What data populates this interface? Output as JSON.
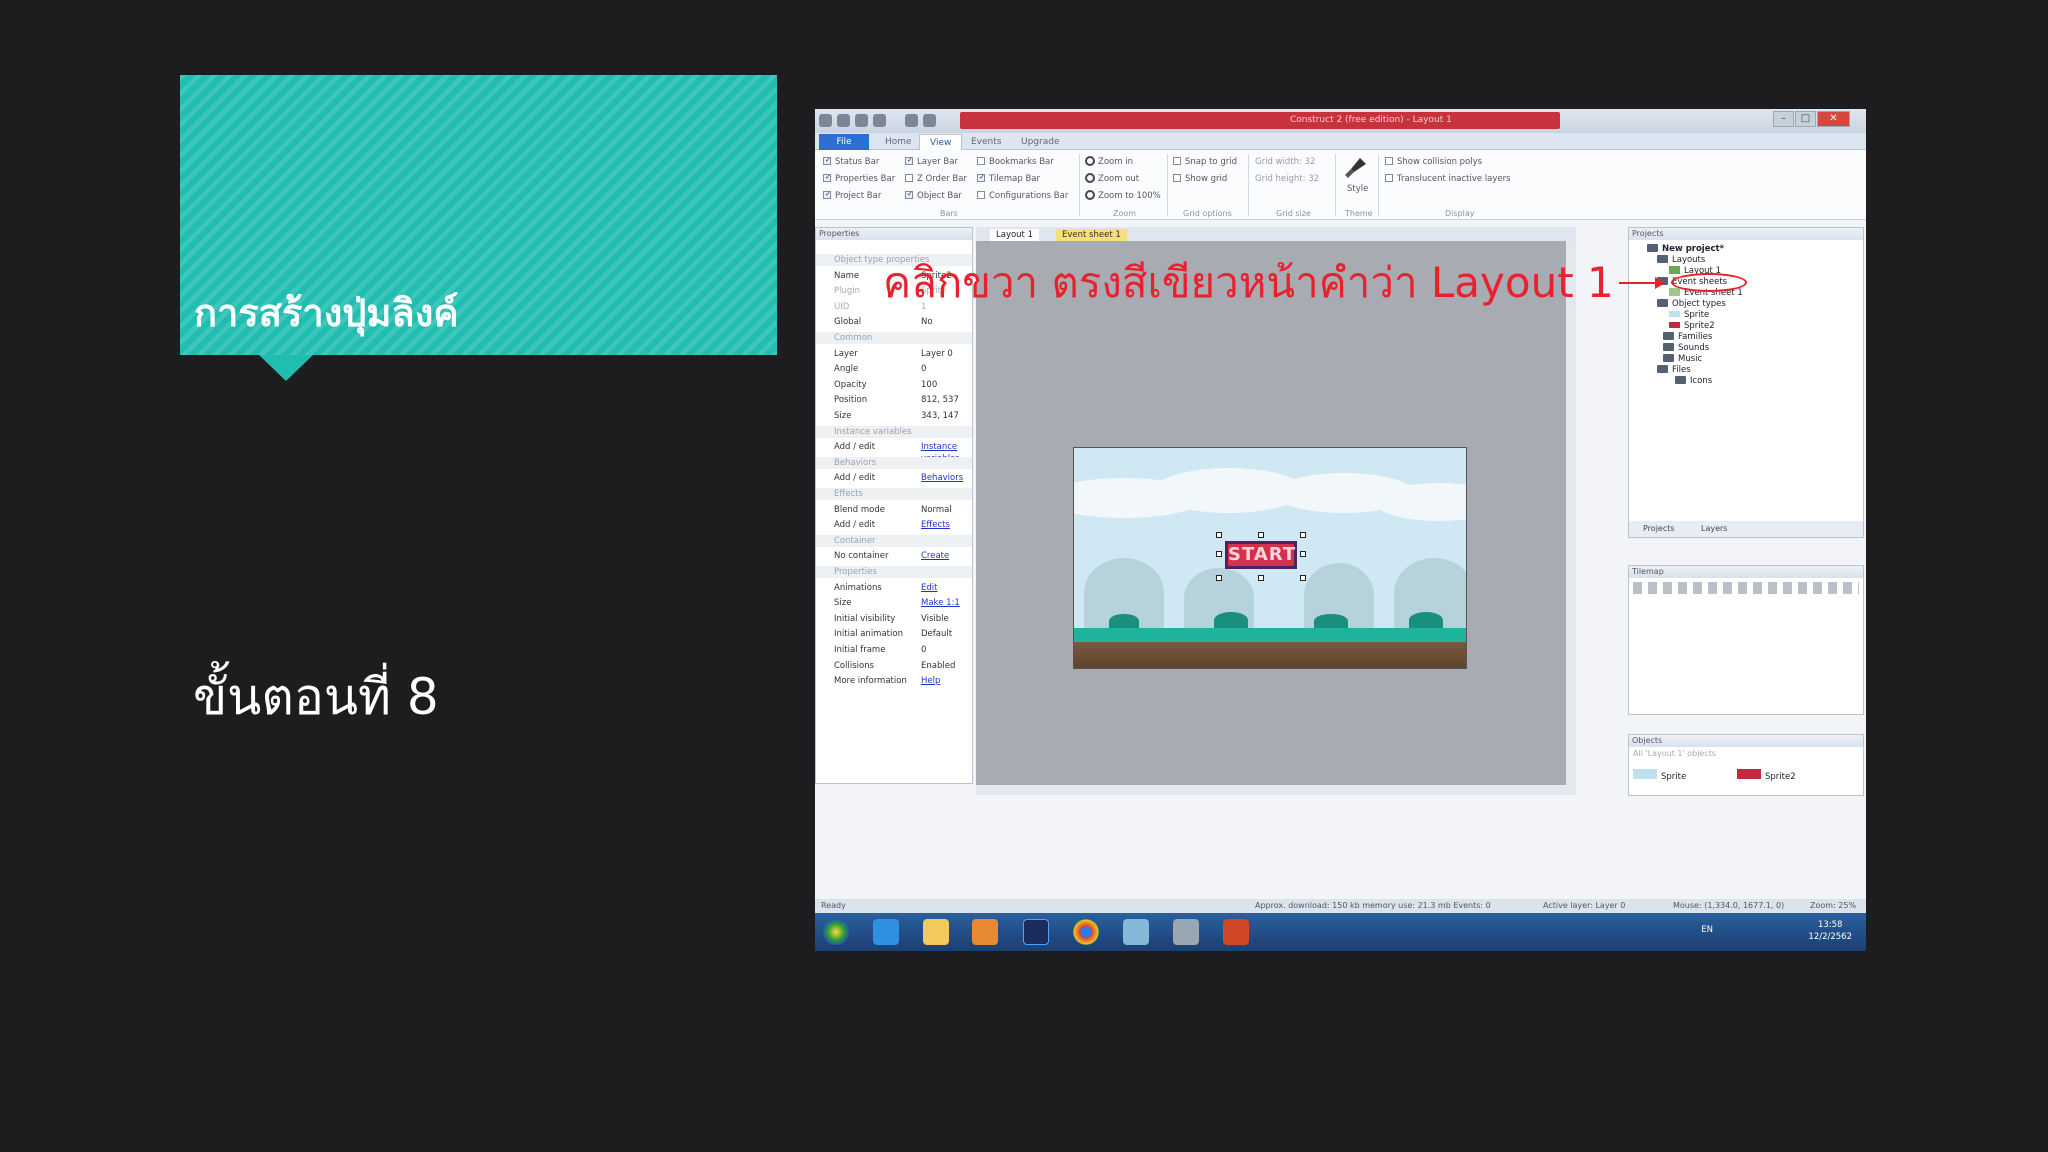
{
  "slide": {
    "title": "การสร้างปุ่มลิงค์",
    "step": "ขั้นตอนที่ 8",
    "annotation": "คลิกขวา ตรงสีเขียวหน้าคำว่า Layout 1"
  },
  "window": {
    "title": "Construct 2 (free edition) - Layout 1"
  },
  "ribbon": {
    "tabs": [
      "File",
      "Home",
      "View",
      "Events",
      "Upgrade"
    ],
    "bars": {
      "col1": [
        "Status Bar",
        "Properties Bar",
        "Project Bar"
      ],
      "col2": [
        "Layer Bar",
        "Z Order Bar",
        "Object Bar"
      ],
      "col3": [
        "Bookmarks Bar",
        "Tilemap Bar",
        "Configurations Bar"
      ]
    },
    "zoom": [
      "Zoom in",
      "Zoom out",
      "Zoom to 100%"
    ],
    "grid": [
      "Snap to grid",
      "Show grid"
    ],
    "grid_size": [
      "Grid width: 32",
      "Grid height: 32"
    ],
    "display": [
      "Show collision polys",
      "Translucent inactive layers"
    ],
    "style_label": "Style",
    "groups": [
      "Bars",
      "Zoom",
      "Grid options",
      "Grid size",
      "Theme",
      "Display"
    ]
  },
  "properties": {
    "title": "Properties",
    "rows": [
      {
        "k": "Object type properties",
        "v": "",
        "grp": true
      },
      {
        "k": "Name",
        "v": "Sprite2"
      },
      {
        "k": "Plugin",
        "v": "Sprite",
        "dim": true
      },
      {
        "k": "UID",
        "v": "1",
        "dim": true
      },
      {
        "k": "Global",
        "v": "No"
      },
      {
        "k": "Common",
        "v": "",
        "grp": true
      },
      {
        "k": "Layer",
        "v": "Layer 0"
      },
      {
        "k": "Angle",
        "v": "0"
      },
      {
        "k": "Opacity",
        "v": "100"
      },
      {
        "k": "Position",
        "v": "812, 537"
      },
      {
        "k": "Size",
        "v": "343, 147"
      },
      {
        "k": "Instance variables",
        "v": "",
        "grp": true
      },
      {
        "k": "Add / edit",
        "v": "Instance variables",
        "link": true
      },
      {
        "k": "Behaviors",
        "v": "",
        "grp": true
      },
      {
        "k": "Add / edit",
        "v": "Behaviors",
        "link": true
      },
      {
        "k": "Effects",
        "v": "",
        "grp": true
      },
      {
        "k": "Blend mode",
        "v": "Normal"
      },
      {
        "k": "Add / edit",
        "v": "Effects",
        "link": true
      },
      {
        "k": "Container",
        "v": "",
        "grp": true
      },
      {
        "k": "No container",
        "v": "Create",
        "link": true
      },
      {
        "k": "Properties",
        "v": "",
        "grp": true
      },
      {
        "k": "Animations",
        "v": "Edit",
        "link": true
      },
      {
        "k": "Size",
        "v": "Make 1:1",
        "link": true
      },
      {
        "k": "Initial visibility",
        "v": "Visible"
      },
      {
        "k": "Initial animation",
        "v": "Default"
      },
      {
        "k": "Initial frame",
        "v": "0"
      },
      {
        "k": "Collisions",
        "v": "Enabled"
      },
      {
        "k": "More information",
        "v": "Help",
        "link": true
      }
    ]
  },
  "documents": {
    "tabs": [
      "Layout 1",
      "Event sheet 1"
    ]
  },
  "canvas": {
    "sprite_text": "START"
  },
  "project": {
    "title": "Projects",
    "tree": [
      "New project*",
      "Layouts",
      "Layout 1",
      "Event sheets",
      "Event sheet 1",
      "Object types",
      "Sprite",
      "Sprite2",
      "Families",
      "Sounds",
      "Music",
      "Files",
      "Icons"
    ],
    "tabs": [
      "Projects",
      "Layers"
    ]
  },
  "tilemap": {
    "title": "Tilemap"
  },
  "objects": {
    "title": "Objects",
    "filter": "All 'Layout 1' objects",
    "items": [
      "Sprite",
      "Sprite2"
    ]
  },
  "status": {
    "left": "Ready",
    "download": "Approx. download: 150 kb  memory use: 21.3 mb  Events: 0",
    "layer": "Active layer: Layer 0",
    "mouse": "Mouse: (1,334.0, 1677.1, 0)",
    "zoom": "Zoom: 25%"
  },
  "taskbar": {
    "lang": "EN",
    "time": "13:58",
    "date": "12/2/2562"
  },
  "colors": {
    "slide_bg": "#1d1d1f",
    "title_card": "#20bdb0",
    "annotation": "#e8212d"
  }
}
